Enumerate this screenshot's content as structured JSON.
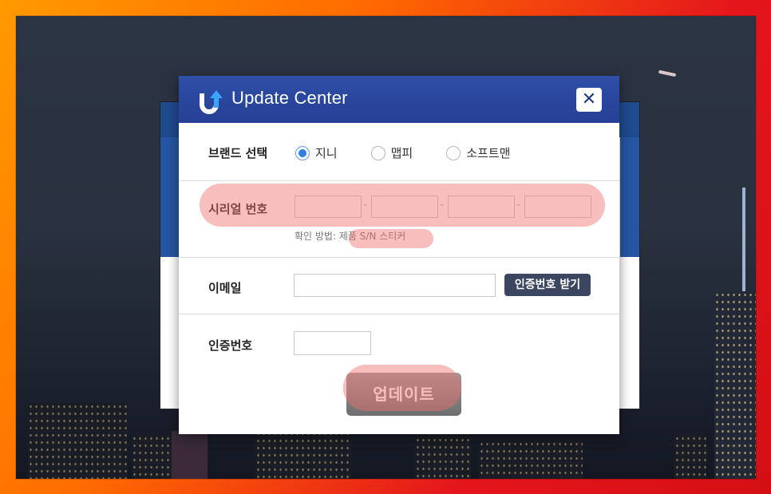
{
  "dialog": {
    "title": "Update Center",
    "close_label": "✕"
  },
  "brand": {
    "label": "브랜드 선택",
    "options": [
      "지니",
      "맵피",
      "소프트맨"
    ],
    "selected_index": 0
  },
  "serial": {
    "label": "시리얼 번호",
    "separator": "-",
    "hint_prefix": "확인 방법:",
    "hint_link": "제품 S/N 스티커"
  },
  "email": {
    "label": "이메일",
    "value": "",
    "verify_button": "인증번호 받기"
  },
  "auth": {
    "label": "인증번호",
    "value": ""
  },
  "update_button": "업데이트",
  "colors": {
    "titlebar": "#2a47a0",
    "radio_accent": "#2f7fe6",
    "verify_button": "#3c4660",
    "highlight": "#f06e6e"
  }
}
